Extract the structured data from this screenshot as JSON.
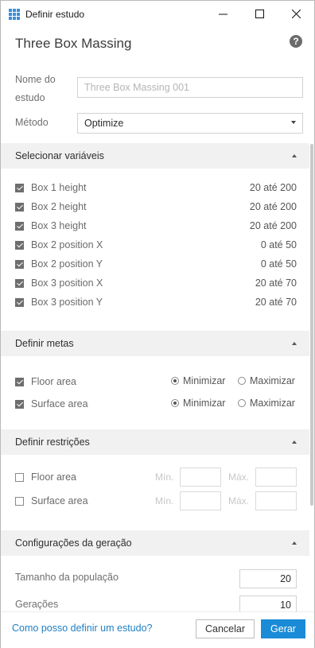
{
  "window": {
    "title": "Definir estudo",
    "minimize": "—",
    "maximize": "☐",
    "close": "✕"
  },
  "header": {
    "title": "Three Box Massing",
    "help_glyph": "?"
  },
  "study": {
    "name_label_1": "Nome do",
    "name_label_2": "estudo",
    "name_placeholder": "Three Box Massing 001",
    "method_label": "Método",
    "method_value": "Optimize"
  },
  "variables": {
    "title": "Selecionar variáveis",
    "items": [
      {
        "name": "Box 1 height",
        "range": "20 até 200",
        "checked": true
      },
      {
        "name": "Box 2 height",
        "range": "20 até 200",
        "checked": true
      },
      {
        "name": "Box 3 height",
        "range": "20 até 200",
        "checked": true
      },
      {
        "name": "Box 2 position X",
        "range": "0 até 50",
        "checked": true
      },
      {
        "name": "Box 2 position Y",
        "range": "0 até 50",
        "checked": true
      },
      {
        "name": "Box 3 position X",
        "range": "20 até 70",
        "checked": true
      },
      {
        "name": "Box 3 position Y",
        "range": "20 até 70",
        "checked": true
      }
    ]
  },
  "goals": {
    "title": "Definir metas",
    "minimize_label": "Minimizar",
    "maximize_label": "Maximizar",
    "items": [
      {
        "name": "Floor area",
        "checked": true,
        "selected": "Minimizar"
      },
      {
        "name": "Surface area",
        "checked": true,
        "selected": "Minimizar"
      }
    ]
  },
  "constraints": {
    "title": "Definir restrições",
    "min_label": "Mín.",
    "max_label": "Máx.",
    "items": [
      {
        "name": "Floor area",
        "checked": false
      },
      {
        "name": "Surface area",
        "checked": false
      }
    ]
  },
  "generation": {
    "title": "Configurações da geração",
    "population_label": "Tamanho da população",
    "population_value": "20",
    "generations_label": "Gerações",
    "generations_value": "10"
  },
  "footer": {
    "help_link": "Como posso definir um estudo?",
    "cancel": "Cancelar",
    "generate": "Gerar"
  },
  "colors": {
    "accent": "#1a8bd7",
    "link": "#1f7fc4",
    "section_bg": "#f1f1f1"
  }
}
